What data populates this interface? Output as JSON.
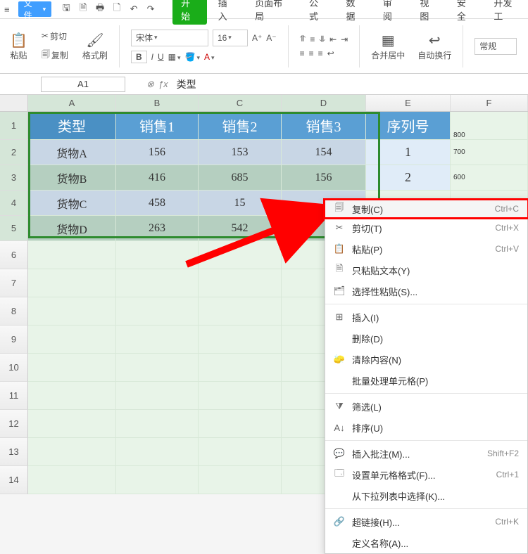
{
  "menubar": {
    "file_label": "文件",
    "tabs": [
      "开始",
      "插入",
      "页面布局",
      "公式",
      "数据",
      "审阅",
      "视图",
      "安全",
      "开发工"
    ]
  },
  "ribbon": {
    "paste": "粘贴",
    "cut": "剪切",
    "copy": "复制",
    "fmt_painter": "格式刷",
    "font_name": "宋体",
    "font_size": "16",
    "merge_center": "合并居中",
    "auto_wrap": "自动换行",
    "general": "常规"
  },
  "namebox": "A1",
  "formula_value": "类型",
  "cols": [
    "A",
    "B",
    "C",
    "D",
    "E",
    "F"
  ],
  "table": {
    "headers": [
      "类型",
      "销售1",
      "销售2",
      "销售3"
    ],
    "rows": [
      {
        "label": "货物A",
        "v": [
          156,
          153,
          154
        ]
      },
      {
        "label": "货物B",
        "v": [
          416,
          685,
          156
        ]
      },
      {
        "label": "货物C",
        "v": [
          458,
          15,
          ""
        ]
      },
      {
        "label": "货物D",
        "v": [
          263,
          542,
          ""
        ]
      }
    ],
    "seq_header": "序列号",
    "seq": [
      "1",
      "2"
    ],
    "side_values": [
      "800",
      "700",
      "600"
    ]
  },
  "chart_data": {
    "type": "table",
    "title": "",
    "headers": [
      "类型",
      "销售1",
      "销售2",
      "销售3",
      "序列号"
    ],
    "rows": [
      [
        "货物A",
        156,
        153,
        154,
        1
      ],
      [
        "货物B",
        416,
        685,
        156,
        2
      ],
      [
        "货物C",
        458,
        15,
        null,
        null
      ],
      [
        "货物D",
        263,
        542,
        null,
        null
      ]
    ]
  },
  "context_menu": [
    {
      "icon": "copy-icon",
      "label": "复制(C)",
      "shortcut": "Ctrl+C",
      "hl": true
    },
    {
      "icon": "cut-icon",
      "label": "剪切(T)",
      "shortcut": "Ctrl+X"
    },
    {
      "icon": "paste-icon",
      "label": "粘贴(P)",
      "shortcut": "Ctrl+V"
    },
    {
      "icon": "paste-text-icon",
      "label": "只粘贴文本(Y)",
      "shortcut": ""
    },
    {
      "icon": "paste-special-icon",
      "label": "选择性粘贴(S)...",
      "shortcut": ""
    },
    {
      "sep": true
    },
    {
      "icon": "insert-icon",
      "label": "插入(I)",
      "shortcut": ""
    },
    {
      "icon": "",
      "label": "删除(D)",
      "shortcut": ""
    },
    {
      "icon": "clear-icon",
      "label": "清除内容(N)",
      "shortcut": ""
    },
    {
      "icon": "",
      "label": "批量处理单元格(P)",
      "shortcut": ""
    },
    {
      "sep": true
    },
    {
      "icon": "filter-icon",
      "label": "筛选(L)",
      "shortcut": ""
    },
    {
      "icon": "sort-icon",
      "label": "排序(U)",
      "shortcut": ""
    },
    {
      "sep": true
    },
    {
      "icon": "comment-icon",
      "label": "插入批注(M)...",
      "shortcut": "Shift+F2"
    },
    {
      "icon": "format-cells-icon",
      "label": "设置单元格格式(F)...",
      "shortcut": "Ctrl+1"
    },
    {
      "icon": "",
      "label": "从下拉列表中选择(K)...",
      "shortcut": ""
    },
    {
      "sep": true
    },
    {
      "icon": "hyperlink-icon",
      "label": "超链接(H)...",
      "shortcut": "Ctrl+K"
    },
    {
      "icon": "",
      "label": "定义名称(A)...",
      "shortcut": ""
    }
  ]
}
